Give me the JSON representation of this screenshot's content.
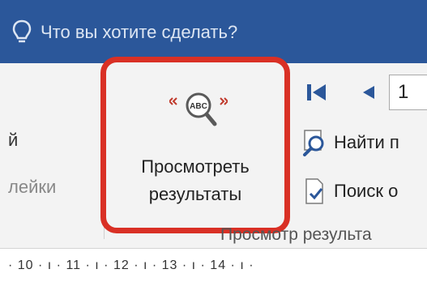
{
  "tell_me": {
    "placeholder": "Что вы хотите сделать?"
  },
  "left_group": {
    "label_top": "й",
    "label_bottom": "лейки"
  },
  "preview_results": {
    "label": "Просмотреть\nрезультаты",
    "icon": "preview-abc-magnifier-icon",
    "highlight_color": "#d93025"
  },
  "navigation": {
    "record_number": "1",
    "first_icon": "first-record-icon",
    "prev_icon": "previous-record-icon"
  },
  "commands": {
    "find": "Найти п",
    "check_errors": "Поиск о"
  },
  "group": {
    "label": "Просмотр результа"
  },
  "ruler": {
    "numbers": "· 10 · ı · 11 · ı · 12 · ı · 13 · ı · 14 · ı ·"
  },
  "colors": {
    "title_bar": "#2b579a",
    "ribbon": "#f3f3f3",
    "icon_blue": "#2b579a"
  }
}
